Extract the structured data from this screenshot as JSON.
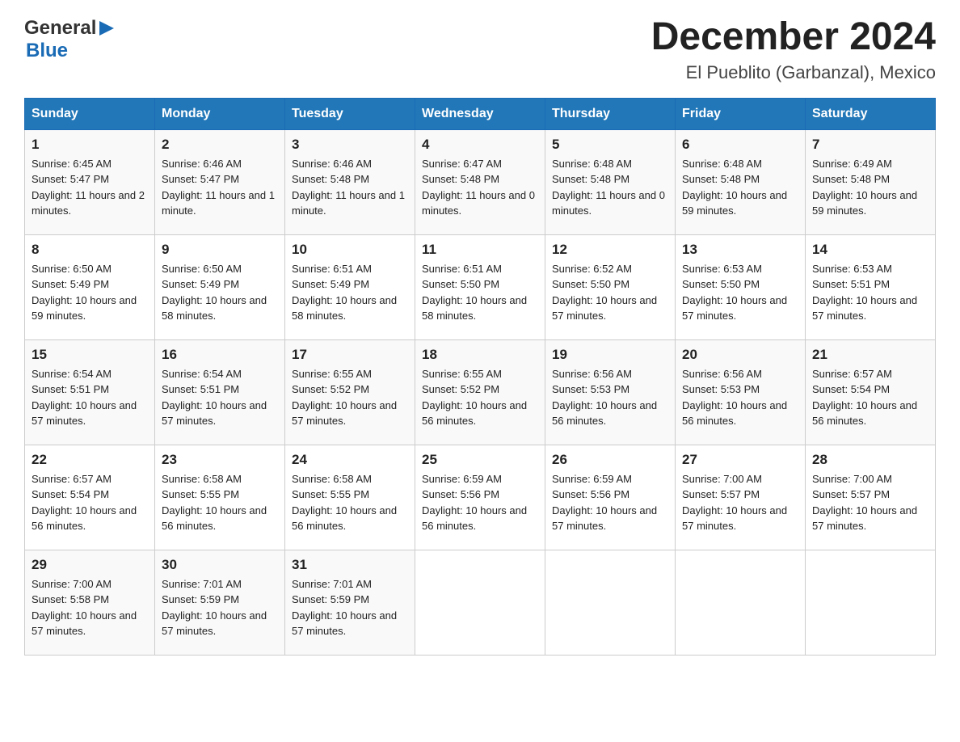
{
  "header": {
    "logo_general": "General",
    "logo_arrow": "▶",
    "logo_blue": "Blue",
    "month_title": "December 2024",
    "location": "El Pueblito (Garbanzal), Mexico"
  },
  "weekdays": [
    "Sunday",
    "Monday",
    "Tuesday",
    "Wednesday",
    "Thursday",
    "Friday",
    "Saturday"
  ],
  "weeks": [
    [
      {
        "day": "1",
        "sunrise": "6:45 AM",
        "sunset": "5:47 PM",
        "daylight": "11 hours and 2 minutes."
      },
      {
        "day": "2",
        "sunrise": "6:46 AM",
        "sunset": "5:47 PM",
        "daylight": "11 hours and 1 minute."
      },
      {
        "day": "3",
        "sunrise": "6:46 AM",
        "sunset": "5:48 PM",
        "daylight": "11 hours and 1 minute."
      },
      {
        "day": "4",
        "sunrise": "6:47 AM",
        "sunset": "5:48 PM",
        "daylight": "11 hours and 0 minutes."
      },
      {
        "day": "5",
        "sunrise": "6:48 AM",
        "sunset": "5:48 PM",
        "daylight": "11 hours and 0 minutes."
      },
      {
        "day": "6",
        "sunrise": "6:48 AM",
        "sunset": "5:48 PM",
        "daylight": "10 hours and 59 minutes."
      },
      {
        "day": "7",
        "sunrise": "6:49 AM",
        "sunset": "5:48 PM",
        "daylight": "10 hours and 59 minutes."
      }
    ],
    [
      {
        "day": "8",
        "sunrise": "6:50 AM",
        "sunset": "5:49 PM",
        "daylight": "10 hours and 59 minutes."
      },
      {
        "day": "9",
        "sunrise": "6:50 AM",
        "sunset": "5:49 PM",
        "daylight": "10 hours and 58 minutes."
      },
      {
        "day": "10",
        "sunrise": "6:51 AM",
        "sunset": "5:49 PM",
        "daylight": "10 hours and 58 minutes."
      },
      {
        "day": "11",
        "sunrise": "6:51 AM",
        "sunset": "5:50 PM",
        "daylight": "10 hours and 58 minutes."
      },
      {
        "day": "12",
        "sunrise": "6:52 AM",
        "sunset": "5:50 PM",
        "daylight": "10 hours and 57 minutes."
      },
      {
        "day": "13",
        "sunrise": "6:53 AM",
        "sunset": "5:50 PM",
        "daylight": "10 hours and 57 minutes."
      },
      {
        "day": "14",
        "sunrise": "6:53 AM",
        "sunset": "5:51 PM",
        "daylight": "10 hours and 57 minutes."
      }
    ],
    [
      {
        "day": "15",
        "sunrise": "6:54 AM",
        "sunset": "5:51 PM",
        "daylight": "10 hours and 57 minutes."
      },
      {
        "day": "16",
        "sunrise": "6:54 AM",
        "sunset": "5:51 PM",
        "daylight": "10 hours and 57 minutes."
      },
      {
        "day": "17",
        "sunrise": "6:55 AM",
        "sunset": "5:52 PM",
        "daylight": "10 hours and 57 minutes."
      },
      {
        "day": "18",
        "sunrise": "6:55 AM",
        "sunset": "5:52 PM",
        "daylight": "10 hours and 56 minutes."
      },
      {
        "day": "19",
        "sunrise": "6:56 AM",
        "sunset": "5:53 PM",
        "daylight": "10 hours and 56 minutes."
      },
      {
        "day": "20",
        "sunrise": "6:56 AM",
        "sunset": "5:53 PM",
        "daylight": "10 hours and 56 minutes."
      },
      {
        "day": "21",
        "sunrise": "6:57 AM",
        "sunset": "5:54 PM",
        "daylight": "10 hours and 56 minutes."
      }
    ],
    [
      {
        "day": "22",
        "sunrise": "6:57 AM",
        "sunset": "5:54 PM",
        "daylight": "10 hours and 56 minutes."
      },
      {
        "day": "23",
        "sunrise": "6:58 AM",
        "sunset": "5:55 PM",
        "daylight": "10 hours and 56 minutes."
      },
      {
        "day": "24",
        "sunrise": "6:58 AM",
        "sunset": "5:55 PM",
        "daylight": "10 hours and 56 minutes."
      },
      {
        "day": "25",
        "sunrise": "6:59 AM",
        "sunset": "5:56 PM",
        "daylight": "10 hours and 56 minutes."
      },
      {
        "day": "26",
        "sunrise": "6:59 AM",
        "sunset": "5:56 PM",
        "daylight": "10 hours and 57 minutes."
      },
      {
        "day": "27",
        "sunrise": "7:00 AM",
        "sunset": "5:57 PM",
        "daylight": "10 hours and 57 minutes."
      },
      {
        "day": "28",
        "sunrise": "7:00 AM",
        "sunset": "5:57 PM",
        "daylight": "10 hours and 57 minutes."
      }
    ],
    [
      {
        "day": "29",
        "sunrise": "7:00 AM",
        "sunset": "5:58 PM",
        "daylight": "10 hours and 57 minutes."
      },
      {
        "day": "30",
        "sunrise": "7:01 AM",
        "sunset": "5:59 PM",
        "daylight": "10 hours and 57 minutes."
      },
      {
        "day": "31",
        "sunrise": "7:01 AM",
        "sunset": "5:59 PM",
        "daylight": "10 hours and 57 minutes."
      },
      null,
      null,
      null,
      null
    ]
  ]
}
